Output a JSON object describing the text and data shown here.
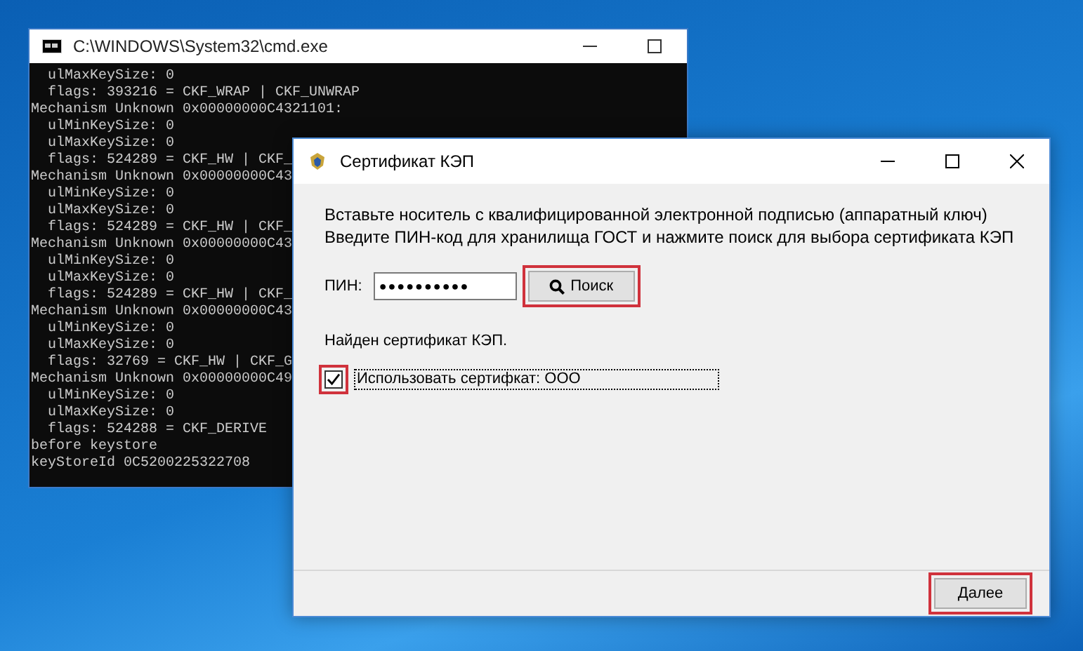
{
  "console_window": {
    "title": "C:\\WINDOWS\\System32\\cmd.exe",
    "lines": [
      "  ulMaxKeySize: 0",
      "  flags: 393216 = CKF_WRAP | CKF_UNWRAP",
      "Mechanism Unknown 0x00000000C4321101:",
      "  ulMinKeySize: 0",
      "  ulMaxKeySize: 0",
      "  flags: 524289 = CKF_HW | CKF_",
      "Mechanism Unknown 0x00000000C43",
      "  ulMinKeySize: 0",
      "  ulMaxKeySize: 0",
      "  flags: 524289 = CKF_HW | CKF_",
      "Mechanism Unknown 0x00000000C43",
      "  ulMinKeySize: 0",
      "  ulMaxKeySize: 0",
      "  flags: 524289 = CKF_HW | CKF_",
      "Mechanism Unknown 0x00000000C43",
      "  ulMinKeySize: 0",
      "  ulMaxKeySize: 0",
      "  flags: 32769 = CKF_HW | CKF_G",
      "Mechanism Unknown 0x00000000C49",
      "  ulMinKeySize: 0",
      "  ulMaxKeySize: 0",
      "  flags: 524288 = CKF_DERIVE",
      "before keystore",
      "keyStoreId 0C5200225322708"
    ]
  },
  "dialog": {
    "title": "Сертификат КЭП",
    "instructions": [
      "Вставьте носитель с квалифицированной электронной подписью (аппаратный ключ)",
      "Введите ПИН-код для хранилища ГОСТ и нажмите поиск для выбора сертификата КЭП"
    ],
    "pin_label": "ПИН:",
    "pin_value": "●●●●●●●●●●",
    "search_button": {
      "label": "Поиск",
      "highlighted": true
    },
    "status": "Найден сертификат КЭП.",
    "certificate_checkbox": {
      "label": "Использовать сертифкат: ООО",
      "checked": true,
      "highlighted": true
    },
    "next_button": {
      "label": "Далее",
      "highlighted": true
    }
  }
}
